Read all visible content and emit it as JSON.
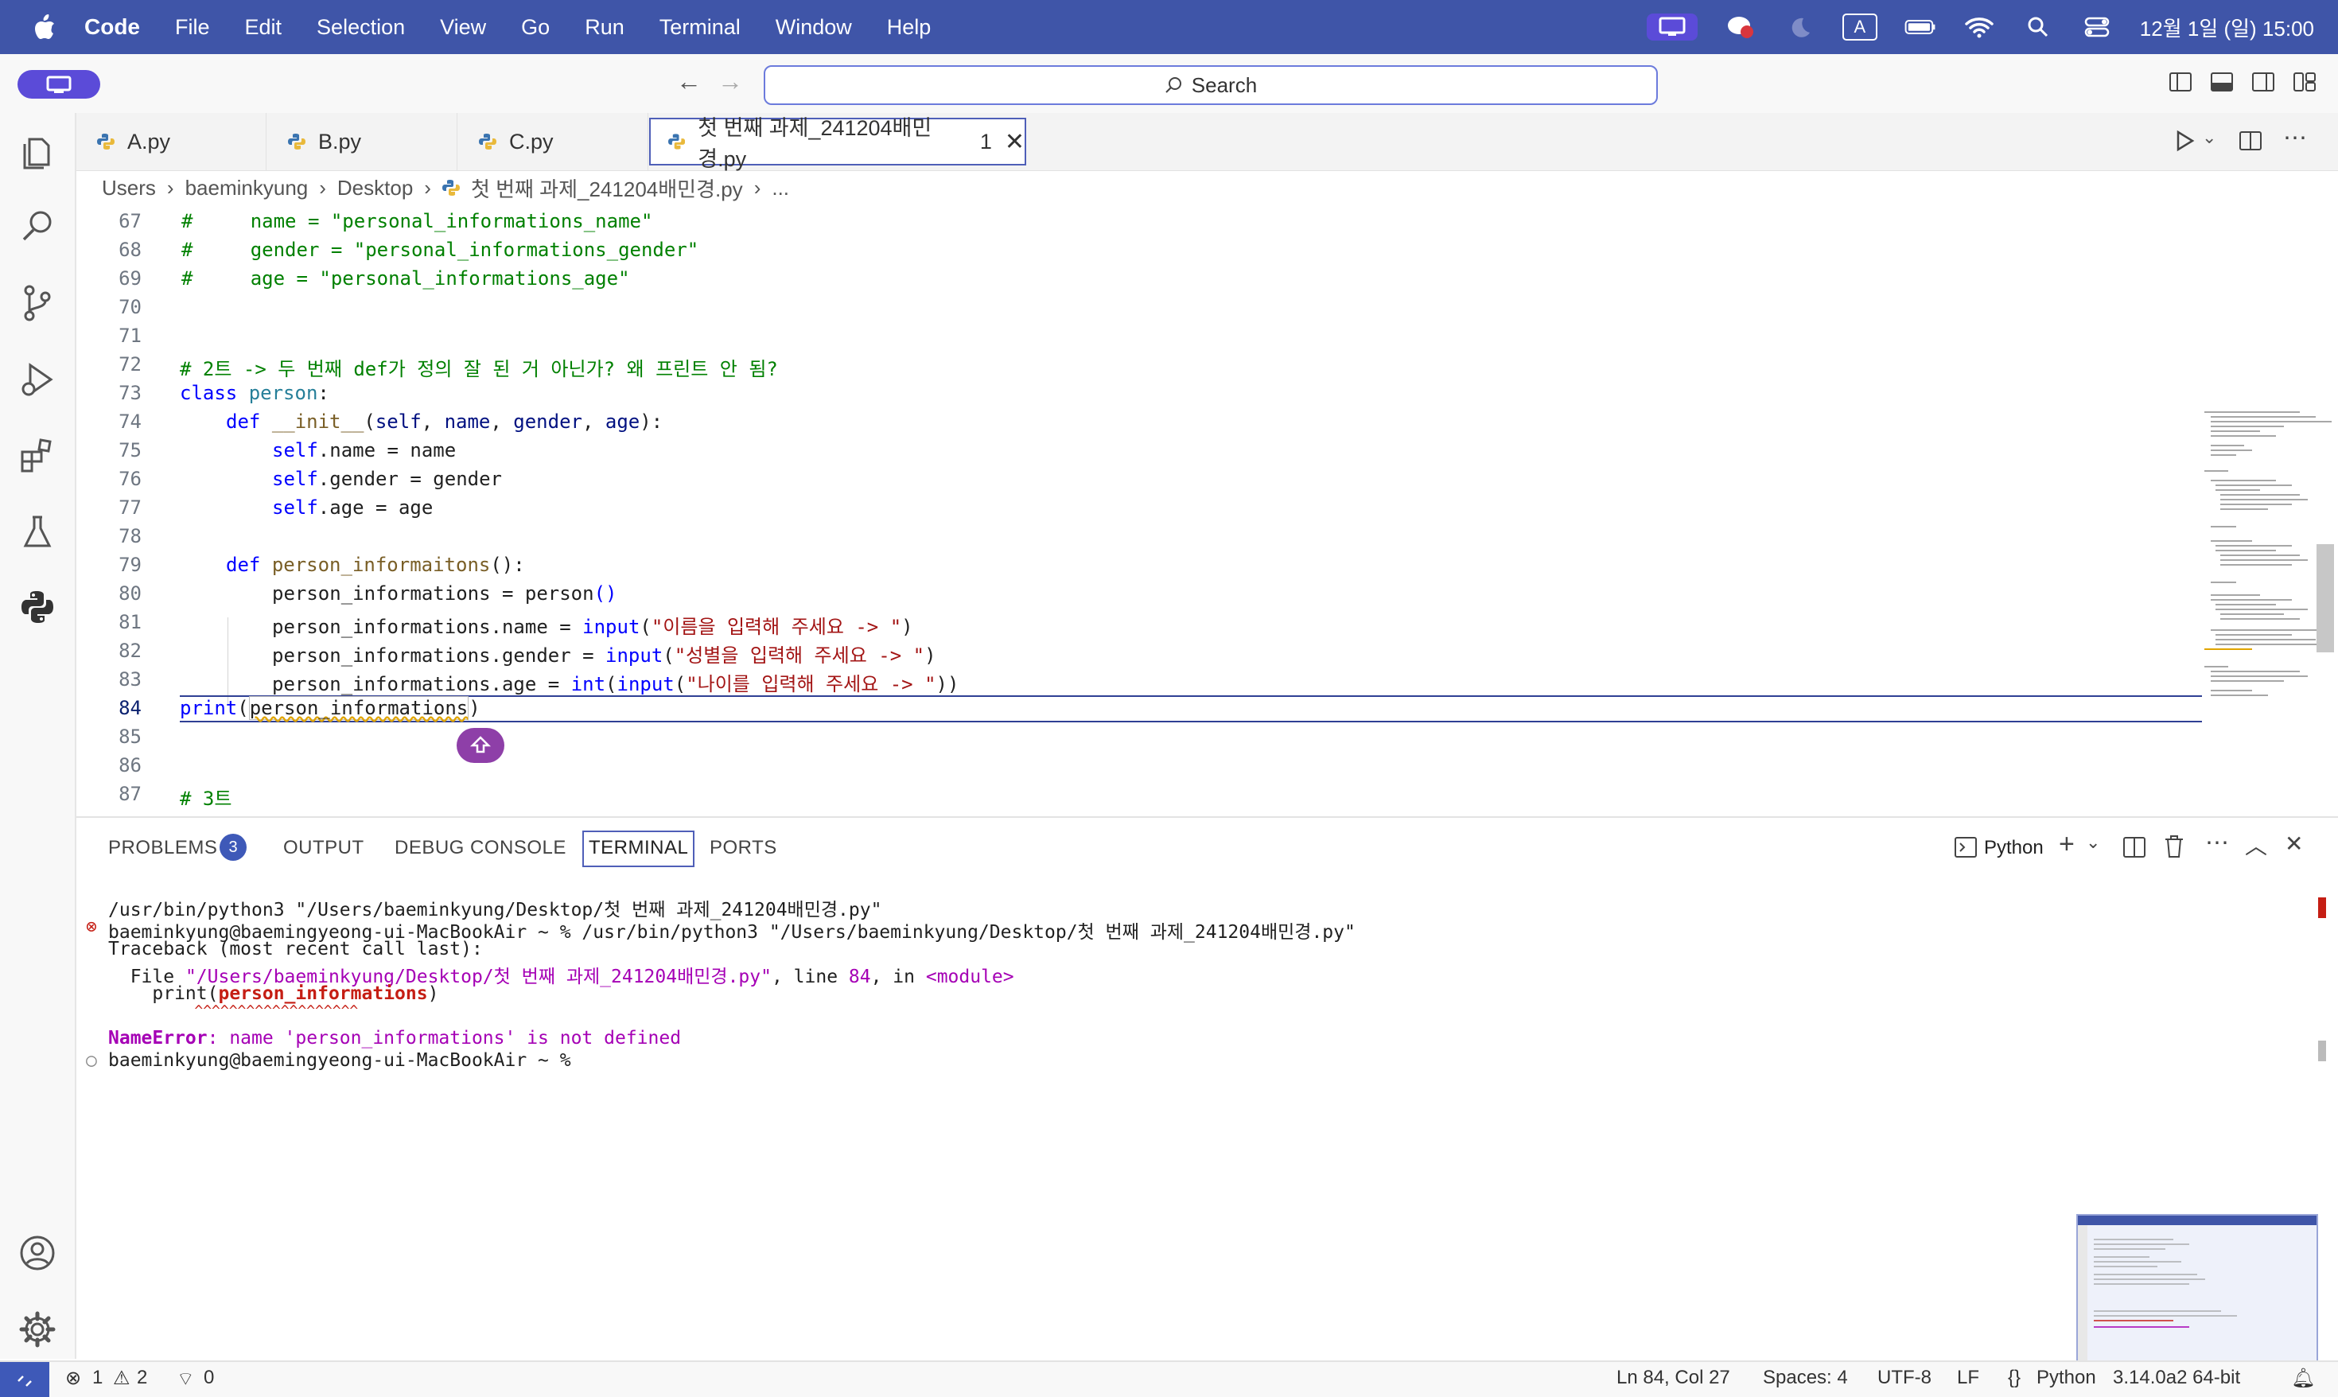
{
  "menubar": {
    "app": "Code",
    "items": [
      "File",
      "Edit",
      "Selection",
      "View",
      "Go",
      "Run",
      "Terminal",
      "Window",
      "Help"
    ],
    "clock": "12월 1일 (일) 15:00",
    "input_source": "A"
  },
  "titlebar": {
    "search_label": "Search"
  },
  "tabs": [
    {
      "label": "A.py"
    },
    {
      "label": "B.py"
    },
    {
      "label": "C.py"
    },
    {
      "label": "첫 번째 과제_241204배민경.py",
      "badge": "1"
    }
  ],
  "breadcrumb": [
    "Users",
    "baeminkyung",
    "Desktop",
    "첫 번째 과제_241204배민경.py",
    "..."
  ],
  "editor": {
    "line_numbers": [
      "67",
      "68",
      "69",
      "70",
      "71",
      "72",
      "73",
      "74",
      "75",
      "76",
      "77",
      "78",
      "79",
      "80",
      "81",
      "82",
      "83",
      "84",
      "85",
      "86",
      "87"
    ],
    "current_line": "84"
  },
  "panel": {
    "tabs": [
      "PROBLEMS",
      "OUTPUT",
      "DEBUG CONSOLE",
      "TERMINAL",
      "PORTS"
    ],
    "problems_count": "3",
    "shell_label": "Python"
  },
  "terminal": {
    "line1": "/usr/bin/python3 \"/Users/baeminkyung/Desktop/첫 번째 과제_241204배민경.py\"",
    "line2_prompt": "baeminkyung@baemingyeong-ui-MacBookAir ~ % /usr/bin/python3 \"/Users/baeminkyung/Desktop/첫 번째 과제_241204배민경.py\"",
    "line3": "Traceback (most recent call last):",
    "line4_a": "  File ",
    "line4_path": "\"/Users/baeminkyung/Desktop/첫 번째 과제_241204배민경.py\"",
    "line4_b": ", line ",
    "line4_num": "84",
    "line4_c": ", in ",
    "line4_mod": "<module>",
    "line5_a": "    print(",
    "line5_var": "person_informations",
    "line5_b": ")",
    "line6": "          ^^^^^^^^^^^^^^^^^^^",
    "line7_err": "NameError",
    "line7_msg": ": name 'person_informations' is not defined",
    "line8_prompt": "baeminkyung@baemingyeong-ui-MacBookAir ~ % "
  },
  "statusbar": {
    "errors": "1",
    "warnings": "2",
    "ports": "0",
    "cursor": "Ln 84, Col 27",
    "spaces": "Spaces: 4",
    "encoding": "UTF-8",
    "eol": "LF",
    "language": "Python",
    "interpreter": "3.14.0a2 64-bit"
  },
  "colors": {
    "menubar": "#3f55a8",
    "accent": "#3e59b8",
    "error": "#c51e14"
  }
}
